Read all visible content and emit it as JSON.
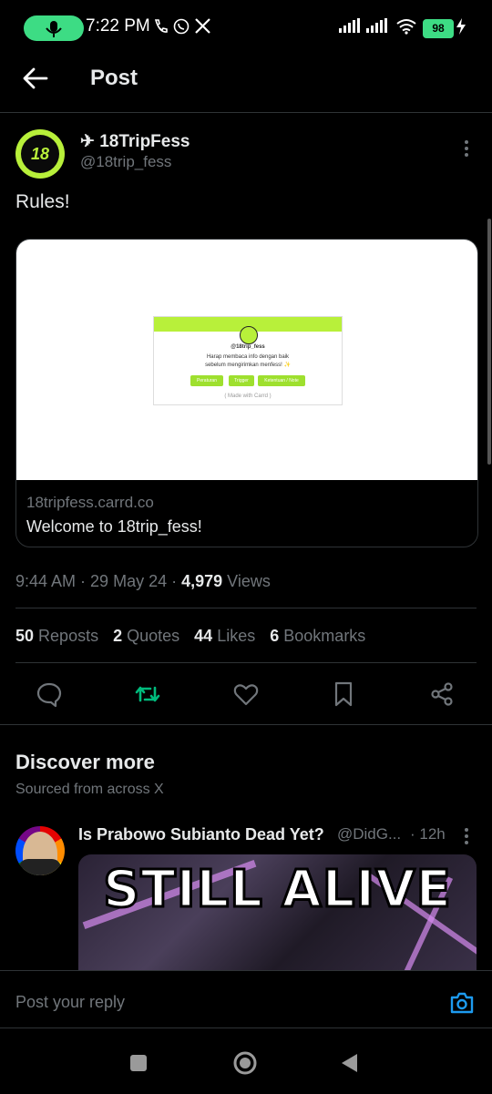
{
  "status_bar": {
    "time": "7:22 PM",
    "battery": "98",
    "icons": [
      "mic-icon",
      "phone-icon",
      "whatsapp-icon",
      "x-icon",
      "signal-icon",
      "signal-icon",
      "wifi-icon",
      "battery-icon",
      "charging-icon"
    ]
  },
  "header": {
    "title": "Post"
  },
  "post": {
    "author_name": "✈ 18TripFess",
    "author_handle": "@18trip_fess",
    "text": "Rules!",
    "card": {
      "preview_handle": "@18trip_fess",
      "preview_line1": "Harap membaca info dengan baik",
      "preview_line2": "sebelum mengirimkan menfess! ✨",
      "preview_btn1": "Peraturan",
      "preview_btn2": "Trigger",
      "preview_btn3": "Ketentuan / Note",
      "preview_footer": "( Made with Carrd )",
      "domain": "18tripfess.carrd.co",
      "title": "Welcome to 18trip_fess!"
    },
    "meta": {
      "time": "9:44 AM",
      "date": "29 May 24",
      "views_count": "4,979",
      "views_label": "Views"
    },
    "stats": [
      {
        "count": "50",
        "label": "Reposts"
      },
      {
        "count": "2",
        "label": "Quotes"
      },
      {
        "count": "44",
        "label": "Likes"
      },
      {
        "count": "6",
        "label": "Bookmarks"
      }
    ]
  },
  "discover": {
    "title": "Discover more",
    "subtitle": "Sourced from across X",
    "item": {
      "name": "Is Prabowo Subianto Dead Yet?",
      "handle": "@DidG...",
      "time": "· 12h",
      "media_text": "STILL ALIVE"
    }
  },
  "reply": {
    "placeholder": "Post your reply"
  },
  "colors": {
    "accent": "#1d9bf0",
    "repost_green": "#00ba7c",
    "brand_lime": "#b8f03a"
  }
}
